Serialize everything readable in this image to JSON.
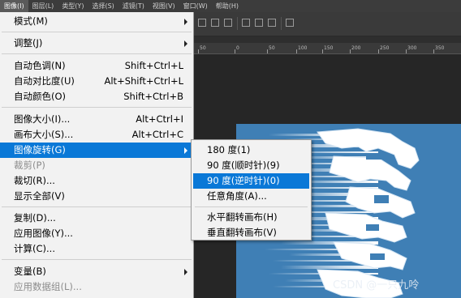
{
  "menubar": {
    "items": [
      {
        "label": "图像(I)",
        "active": true
      },
      {
        "label": "图层(L)"
      },
      {
        "label": "类型(Y)"
      },
      {
        "label": "选择(S)"
      },
      {
        "label": "滤镜(T)"
      },
      {
        "label": "视图(V)"
      },
      {
        "label": "窗口(W)"
      },
      {
        "label": "帮助(H)"
      }
    ]
  },
  "ruler": {
    "ticks": [
      "50",
      "0",
      "50",
      "100",
      "150",
      "200",
      "250",
      "300",
      "350"
    ]
  },
  "image_menu": {
    "items": [
      {
        "label": "模式(M)",
        "shortcut": "",
        "submenu": true
      },
      {
        "label": "调整(J)",
        "shortcut": "",
        "submenu": true
      },
      {
        "label": "自动色调(N)",
        "shortcut": "Shift+Ctrl+L"
      },
      {
        "label": "自动对比度(U)",
        "shortcut": "Alt+Shift+Ctrl+L"
      },
      {
        "label": "自动颜色(O)",
        "shortcut": "Shift+Ctrl+B"
      },
      {
        "label": "图像大小(I)...",
        "shortcut": "Alt+Ctrl+I"
      },
      {
        "label": "画布大小(S)...",
        "shortcut": "Alt+Ctrl+C"
      },
      {
        "label": "图像旋转(G)",
        "shortcut": "",
        "submenu": true,
        "highlighted": true
      },
      {
        "label": "裁剪(P)",
        "shortcut": "",
        "disabled": true
      },
      {
        "label": "裁切(R)...",
        "shortcut": ""
      },
      {
        "label": "显示全部(V)",
        "shortcut": ""
      },
      {
        "label": "复制(D)...",
        "shortcut": ""
      },
      {
        "label": "应用图像(Y)...",
        "shortcut": ""
      },
      {
        "label": "计算(C)...",
        "shortcut": ""
      },
      {
        "label": "变量(B)",
        "shortcut": "",
        "submenu": true
      },
      {
        "label": "应用数据组(L)...",
        "shortcut": "",
        "disabled": true
      }
    ]
  },
  "rotation_submenu": {
    "items": [
      {
        "label": "180 度(1)"
      },
      {
        "label": "90 度(顺时针)(9)"
      },
      {
        "label": "90 度(逆时针)(0)",
        "highlighted": true
      },
      {
        "label": "任意角度(A)..."
      },
      {
        "label": "水平翻转画布(H)"
      },
      {
        "label": "垂直翻转画布(V)"
      }
    ]
  },
  "watermark": "CSDN @一只九呤",
  "colors": {
    "highlight": "#0a78d7",
    "menu_bg": "#f2f2f2",
    "canvas_blue": "#3f7fb5",
    "workspace_bg": "#262626"
  }
}
